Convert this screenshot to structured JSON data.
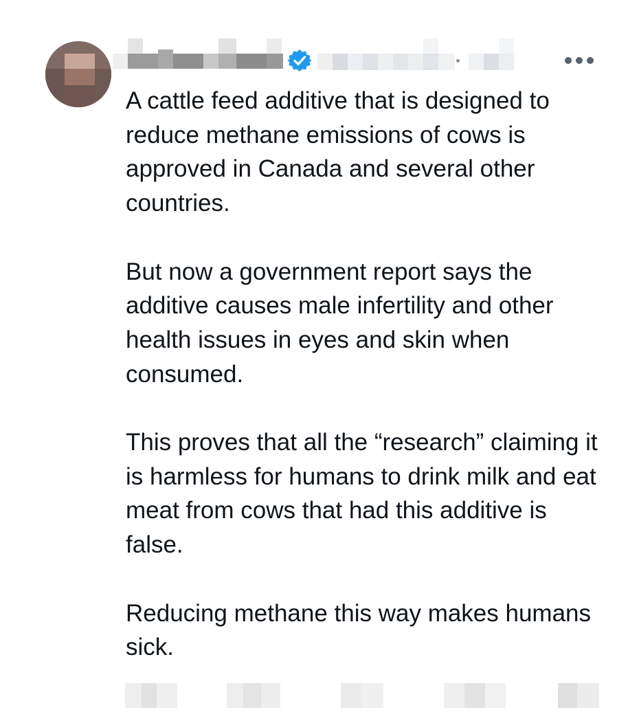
{
  "post": {
    "author_redacted": true,
    "verified": true,
    "paragraphs": [
      "A cattle feed additive that is designed to reduce methane emissions of cows is approved in Canada and several other countries.",
      "But now a government report says the additive causes male infertility and other health issues in eyes and skin when consumed.",
      "This proves that all the “research” claiming it is harmless for humans to drink milk and eat meat from cows that had this additive is false.",
      "Reducing methane this way makes humans sick."
    ]
  },
  "icons": {
    "verified": "verified-badge-icon",
    "more": "more-horizontal-icon"
  },
  "colors": {
    "verified_blue": "#1d9bf0",
    "text": "#0f1419",
    "muted": "#536471"
  }
}
